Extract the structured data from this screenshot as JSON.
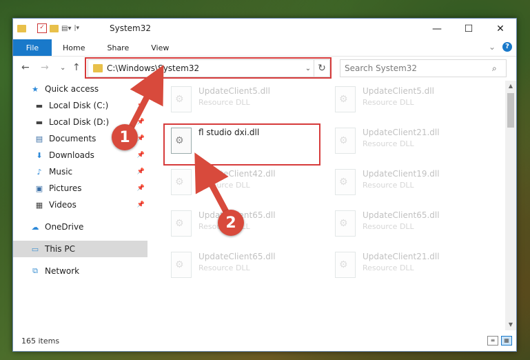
{
  "window": {
    "title": "System32",
    "controls": {
      "minimize": "—",
      "maximize": "☐",
      "close": "✕"
    }
  },
  "ribbon": {
    "file_tab": "File",
    "tabs": [
      "Home",
      "Share",
      "View"
    ],
    "expand_icon": "⌄",
    "help_icon": "?"
  },
  "nav": {
    "back": "←",
    "forward": "→",
    "recent": "⌄",
    "up": "↑",
    "address": "C:\\Windows\\System32",
    "address_dropdown": "⌄",
    "refresh": "↻",
    "search_placeholder": "Search System32",
    "search_icon": "⌕"
  },
  "sidebar": {
    "items": [
      {
        "label": "Quick access",
        "icon": "star-icon",
        "glyph": "★",
        "color": "#2b88d8",
        "pinned": false
      },
      {
        "label": "Local Disk (C:)",
        "icon": "drive-icon",
        "glyph": "▬",
        "color": "#444",
        "pinned": true
      },
      {
        "label": "Local Disk (D:)",
        "icon": "drive-icon",
        "glyph": "▬",
        "color": "#444",
        "pinned": true
      },
      {
        "label": "Documents",
        "icon": "document-icon",
        "glyph": "▤",
        "color": "#3a6ea5",
        "pinned": true
      },
      {
        "label": "Downloads",
        "icon": "download-icon",
        "glyph": "⬇",
        "color": "#2b88d8",
        "pinned": true
      },
      {
        "label": "Music",
        "icon": "music-icon",
        "glyph": "♪",
        "color": "#2b88d8",
        "pinned": true
      },
      {
        "label": "Pictures",
        "icon": "pictures-icon",
        "glyph": "▣",
        "color": "#3a6ea5",
        "pinned": true
      },
      {
        "label": "Videos",
        "icon": "video-icon",
        "glyph": "▦",
        "color": "#444",
        "pinned": true
      },
      {
        "label": "OneDrive",
        "icon": "cloud-icon",
        "glyph": "☁",
        "color": "#2b88d8",
        "pinned": false
      },
      {
        "label": "This PC",
        "icon": "computer-icon",
        "glyph": "▭",
        "color": "#3a8fd0",
        "pinned": false
      },
      {
        "label": "Network",
        "icon": "network-icon",
        "glyph": "⧉",
        "color": "#3a8fd0",
        "pinned": false
      }
    ],
    "pin_glyph": "📌"
  },
  "files": {
    "selected": {
      "name": "fl studio dxi.dll",
      "type": ""
    },
    "left_column": [
      {
        "name": "UpdateClient5.dll",
        "type": "Resource DLL"
      },
      {
        "name": "UpdateClient42.dll",
        "type": "Resource DLL"
      },
      {
        "name": "UpdateClient65.dll",
        "type": "Resource DLL"
      },
      {
        "name": "UpdateClient65.dll",
        "type": "Resource DLL"
      }
    ],
    "right_column": [
      {
        "name": "UpdateClient5.dll",
        "type": "Resource DLL"
      },
      {
        "name": "UpdateClient21.dll",
        "type": "Resource DLL"
      },
      {
        "name": "UpdateClient19.dll",
        "type": "Resource DLL"
      },
      {
        "name": "UpdateClient65.dll",
        "type": "Resource DLL"
      },
      {
        "name": "UpdateClient21.dll",
        "type": "Resource DLL"
      }
    ]
  },
  "status": {
    "item_count": "165 items"
  },
  "annotations": {
    "step1": "1",
    "step2": "2",
    "color": "#d63a3a"
  }
}
